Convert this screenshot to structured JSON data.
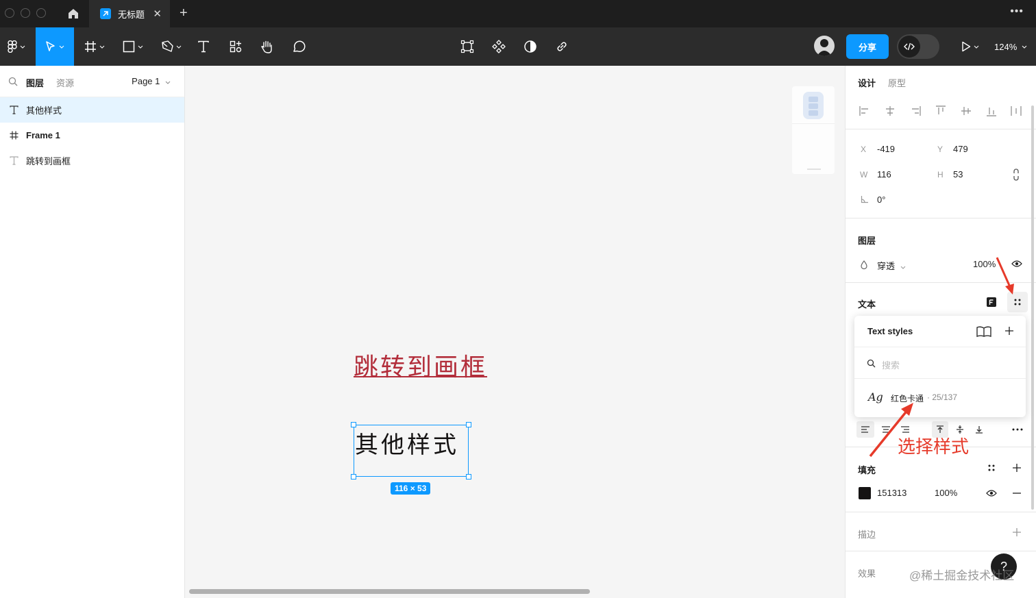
{
  "titlebar": {
    "tab_title": "无标题",
    "close": "✕",
    "add": "+",
    "more": "•••"
  },
  "toolbar": {
    "share_label": "分享",
    "zoom_label": "124%"
  },
  "left_panel": {
    "tabs": [
      "图层",
      "资源"
    ],
    "page_label": "Page 1",
    "layers": [
      {
        "name": "其他样式",
        "type": "text"
      },
      {
        "name": "Frame 1",
        "type": "frame"
      },
      {
        "name": "跳转到画框",
        "type": "text"
      }
    ]
  },
  "canvas": {
    "red_text": "跳转到画框",
    "selected_text": "其他样式",
    "dimension_badge": "116 × 53"
  },
  "right_panel": {
    "tabs": [
      "设计",
      "原型"
    ],
    "x_label": "X",
    "x_value": "-419",
    "y_label": "Y",
    "y_value": "479",
    "w_label": "W",
    "w_value": "116",
    "h_label": "H",
    "h_value": "53",
    "rotation_value": "0°",
    "layer_title": "图层",
    "blend_mode": "穿透",
    "opacity": "100%",
    "text_title": "文本",
    "fill_title": "填充",
    "fill_hex": "151313",
    "fill_color": "#151313",
    "fill_opacity": "100%",
    "stroke_title": "描边",
    "effects_title": "效果"
  },
  "text_styles_popup": {
    "title": "Text styles",
    "search_placeholder": "搜索",
    "item_preview": "Ag",
    "item_name": "红色卡通",
    "item_meta": "· 25/137"
  },
  "annotation": "选择样式",
  "watermark": "@稀土掘金技术社区",
  "help": "?"
}
